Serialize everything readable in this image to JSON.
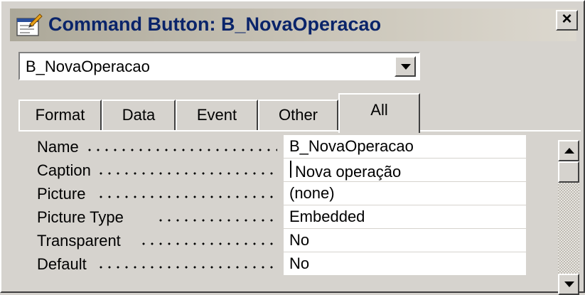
{
  "window": {
    "title": "Command Button: B_NovaOperacao",
    "close_label": "×",
    "title_gradient_start": "#aca899",
    "title_text_color": "#0a246a"
  },
  "object_selector": {
    "value": "B_NovaOperacao"
  },
  "tabs": [
    {
      "label": "Format",
      "active": false
    },
    {
      "label": "Data",
      "active": false
    },
    {
      "label": "Event",
      "active": false
    },
    {
      "label": "Other",
      "active": false
    },
    {
      "label": "All",
      "active": true
    }
  ],
  "properties": [
    {
      "name": "Name",
      "value": "B_NovaOperacao"
    },
    {
      "name": "Caption",
      "value": "Nova operação"
    },
    {
      "name": "Picture",
      "value": "(none)"
    },
    {
      "name": "Picture Type",
      "value": "Embedded"
    },
    {
      "name": "Transparent",
      "value": "No"
    },
    {
      "name": "Default",
      "value": "No"
    }
  ],
  "icons": {
    "title": "properties-sheet-icon",
    "combo": "chevron-down-icon",
    "scroll_up": "scroll-up-arrow-icon",
    "scroll_down": "scroll-down-arrow-icon"
  }
}
